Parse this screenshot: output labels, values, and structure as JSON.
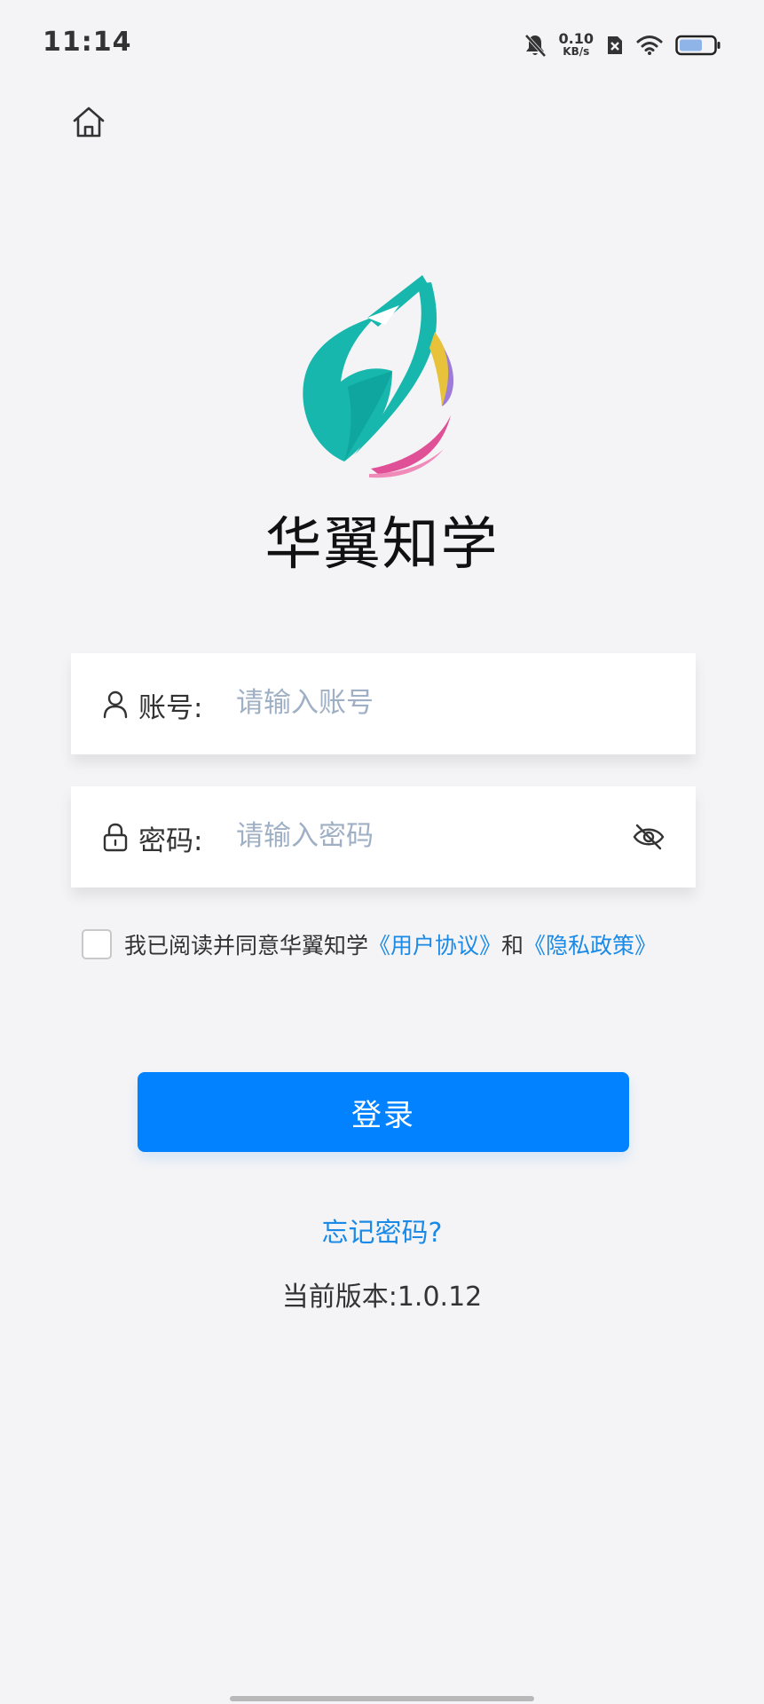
{
  "status_bar": {
    "time": "11:14",
    "net_speed_value": "0.10",
    "net_speed_unit": "KB/s",
    "icons": [
      "bell-muted-icon",
      "sim-off-icon",
      "wifi-icon",
      "battery-icon"
    ]
  },
  "nav": {
    "home_icon": "home-icon"
  },
  "app": {
    "name": "华翼知学"
  },
  "form": {
    "account": {
      "label": "账号:",
      "placeholder": "请输入账号",
      "icon": "user-icon"
    },
    "password": {
      "label": "密码:",
      "placeholder": "请输入密码",
      "icon": "lock-icon",
      "toggle_icon": "eye-off-icon"
    }
  },
  "agreement": {
    "text": "我已阅读并同意华翼知学",
    "user_agreement": "《用户协议》",
    "and": "和",
    "privacy_policy": "《隐私政策》",
    "checked": false
  },
  "login_button": "登录",
  "forgot_password": "忘记密码?",
  "version": "当前版本:1.0.12",
  "colors": {
    "background": "#f4f4f6",
    "accent": "#0282ff",
    "link": "#1a8ae6",
    "placeholder": "#9fb0c4",
    "logo_teal": "#17b7ad"
  }
}
